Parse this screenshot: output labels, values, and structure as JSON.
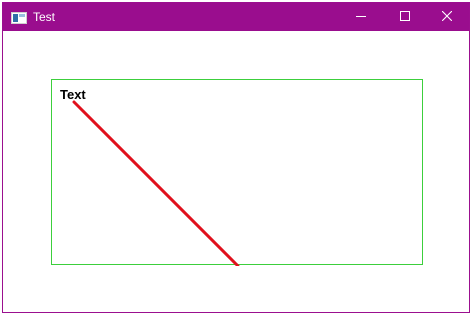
{
  "window": {
    "title": "Test",
    "titlebar_color": "#9a0d8e",
    "border_color": "#9b0f8f",
    "controls": {
      "minimize_icon": "minimize-icon",
      "maximize_icon": "maximize-icon",
      "close_icon": "close-icon"
    }
  },
  "canvas": {
    "text": "Text",
    "frame_color": "#3ccf3c",
    "line_color": "#e0101c"
  }
}
